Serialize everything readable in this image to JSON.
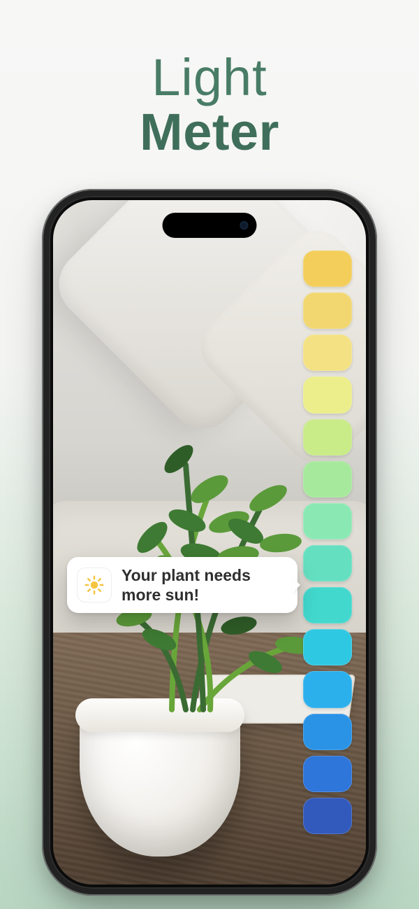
{
  "title": {
    "line1": "Light",
    "line2": "Meter"
  },
  "tooltip": {
    "message": "Your plant needs more sun!",
    "icon": "sun-icon"
  },
  "meter": {
    "colors": [
      "#f3ce5a",
      "#f2d770",
      "#f4e183",
      "#ebee8b",
      "#c9eb88",
      "#a6e99c",
      "#8ae8b3",
      "#64e0c0",
      "#42d8cd",
      "#2fc8e2",
      "#2bb0ec",
      "#2a93e6",
      "#2e76da",
      "#325abc"
    ]
  },
  "colors": {
    "accent": "#3f6f5a"
  }
}
